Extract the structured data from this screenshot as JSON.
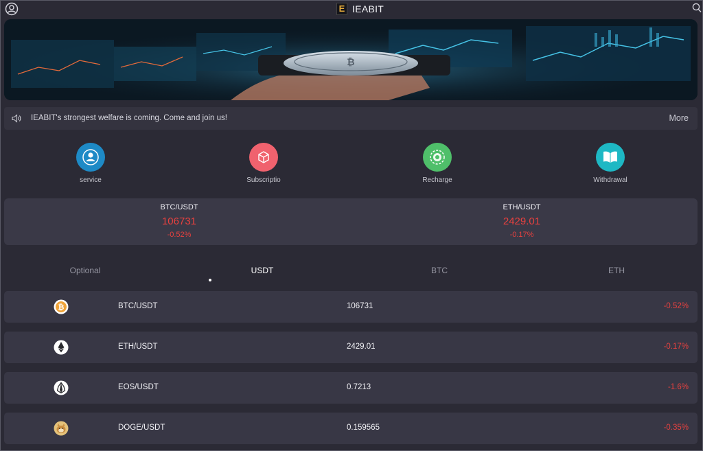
{
  "header": {
    "title": "IEABIT",
    "logo_letter": "E"
  },
  "notice": {
    "text": "IEABIT's strongest welfare is coming. Come and join us!",
    "more": "More"
  },
  "actions": [
    {
      "label": "service",
      "color": "#1e8ac6",
      "icon": "user-badge-icon"
    },
    {
      "label": "Subscriptio",
      "color": "#f0626e",
      "icon": "cube-icon"
    },
    {
      "label": "Recharge",
      "color": "#4fbf6a",
      "icon": "coin-icon"
    },
    {
      "label": "Withdrawal",
      "color": "#1eb8c4",
      "icon": "book-icon"
    }
  ],
  "tickers": [
    {
      "pair": "BTC/USDT",
      "price": "106731",
      "change": "-0.52%"
    },
    {
      "pair": "ETH/USDT",
      "price": "2429.01",
      "change": "-0.17%"
    }
  ],
  "tabs": [
    {
      "label": "Optional",
      "active": false
    },
    {
      "label": "USDT",
      "active": true
    },
    {
      "label": "BTC",
      "active": false
    },
    {
      "label": "ETH",
      "active": false
    }
  ],
  "market": [
    {
      "pair": "BTC/USDT",
      "price": "106731",
      "change": "-0.52%",
      "icon": "bitcoin-icon"
    },
    {
      "pair": "ETH/USDT",
      "price": "2429.01",
      "change": "-0.17%",
      "icon": "ethereum-icon"
    },
    {
      "pair": "EOS/USDT",
      "price": "0.7213",
      "change": "-1.6%",
      "icon": "eos-icon"
    },
    {
      "pair": "DOGE/USDT",
      "price": "0.159565",
      "change": "-0.35%",
      "icon": "dogecoin-icon"
    }
  ],
  "colors": {
    "background": "#2b2a35",
    "card": "#383745",
    "negative": "#e8413f"
  }
}
